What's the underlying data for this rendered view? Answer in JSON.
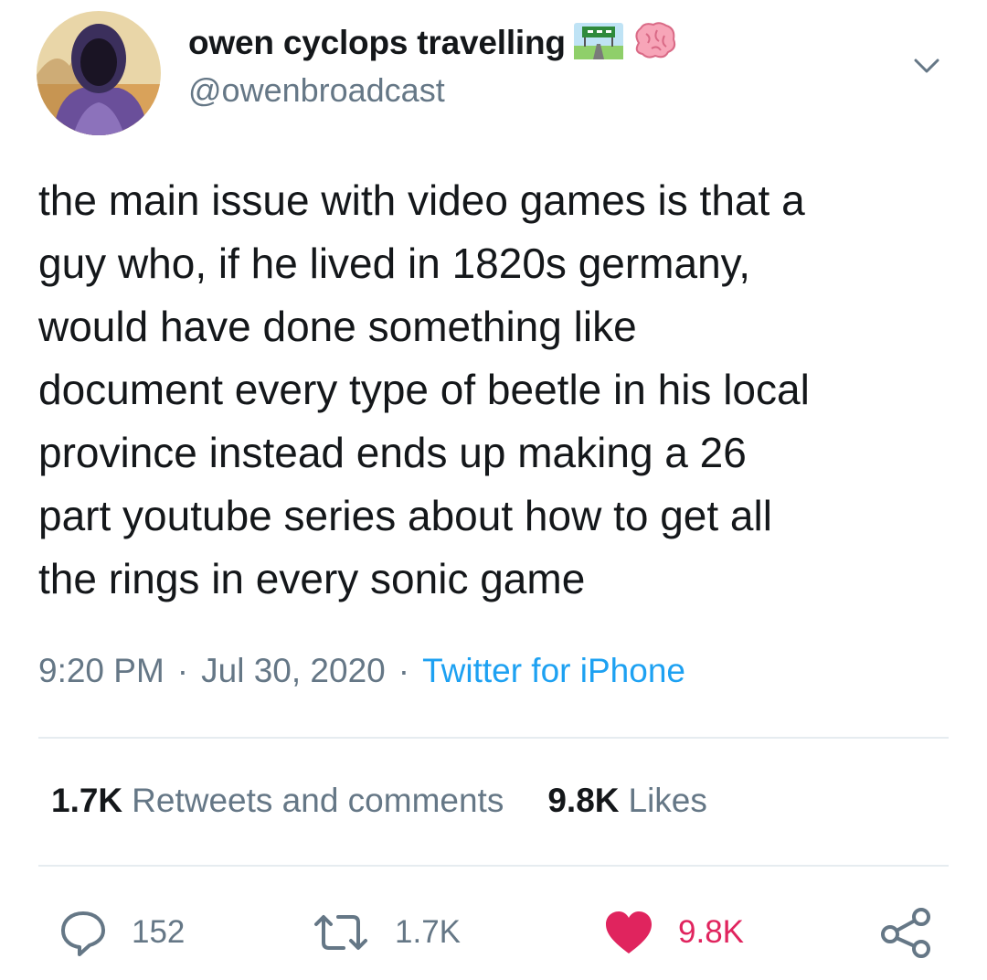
{
  "user": {
    "display_name": "owen cyclops travelling",
    "handle": "@owenbroadcast",
    "emoji_icons": [
      "highway-sign-icon",
      "brain-icon"
    ]
  },
  "tweet": {
    "text": "the main issue with video games is that a\nguy who, if he lived in 1820s germany,\nwould have done something like\ndocument every type of beetle in his local\nprovince instead ends up making a 26\npart youtube series about how to get all\nthe rings in every sonic game",
    "time": "9:20 PM",
    "date": "Jul 30, 2020",
    "separator": "·",
    "source": "Twitter for iPhone"
  },
  "stats": {
    "retweets_count": "1.7K",
    "retweets_label": "Retweets and comments",
    "likes_count": "9.8K",
    "likes_label": "Likes"
  },
  "actions": {
    "reply_count": "152",
    "retweet_count": "1.7K",
    "like_count": "9.8K"
  },
  "colors": {
    "link": "#1da1f2",
    "secondary_text": "#657786",
    "like": "#e0245e",
    "divider": "#e6ecf0"
  }
}
